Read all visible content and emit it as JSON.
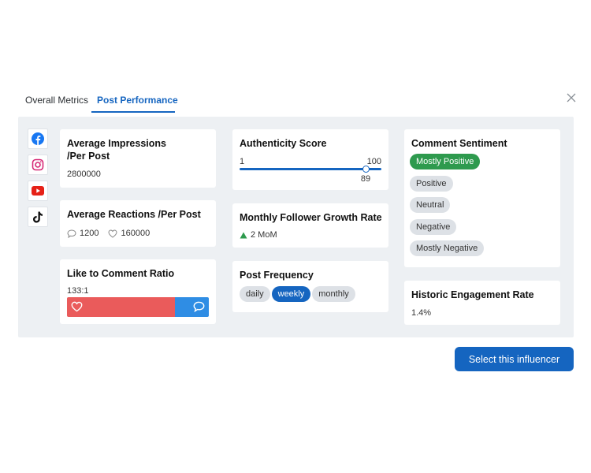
{
  "tabs": [
    {
      "label": "Overall Metrics",
      "active": false
    },
    {
      "label": "Post Performance",
      "active": true
    }
  ],
  "socials": [
    "facebook-icon",
    "instagram-icon",
    "youtube-icon",
    "tiktok-icon"
  ],
  "impressions": {
    "title": "Average Impressions /Per Post",
    "value": "2800000"
  },
  "reactions": {
    "title": "Average Reactions /Per Post",
    "comments": "1200",
    "likes": "160000"
  },
  "ratio": {
    "title": "Like to Comment Ratio",
    "value": "133:1",
    "likes_share": 0.76
  },
  "authenticity": {
    "title": "Authenticity Score",
    "min": "1",
    "max": "100",
    "value": "89",
    "score": 89,
    "range": [
      1,
      100
    ]
  },
  "growth": {
    "title": "Monthly Follower Growth Rate",
    "value": "2 MoM"
  },
  "frequency": {
    "title": "Post Frequency",
    "options": [
      "daily",
      "weekly",
      "monthly"
    ],
    "selected": "weekly"
  },
  "sentiment": {
    "title": "Comment Sentiment",
    "options": [
      "Mostly Positive",
      "Positive",
      "Neutral",
      "Negative",
      "Mostly Negative"
    ],
    "selected": "Mostly Positive"
  },
  "historic": {
    "title": "Historic Engagement Rate",
    "value": "1.4%"
  },
  "action_button": "Select this influencer",
  "colors": {
    "primary": "#1565c0",
    "positive": "#2e9a4e",
    "like": "#ea5b5b",
    "comment": "#2f8de4",
    "growth": "#2e9a4e"
  }
}
